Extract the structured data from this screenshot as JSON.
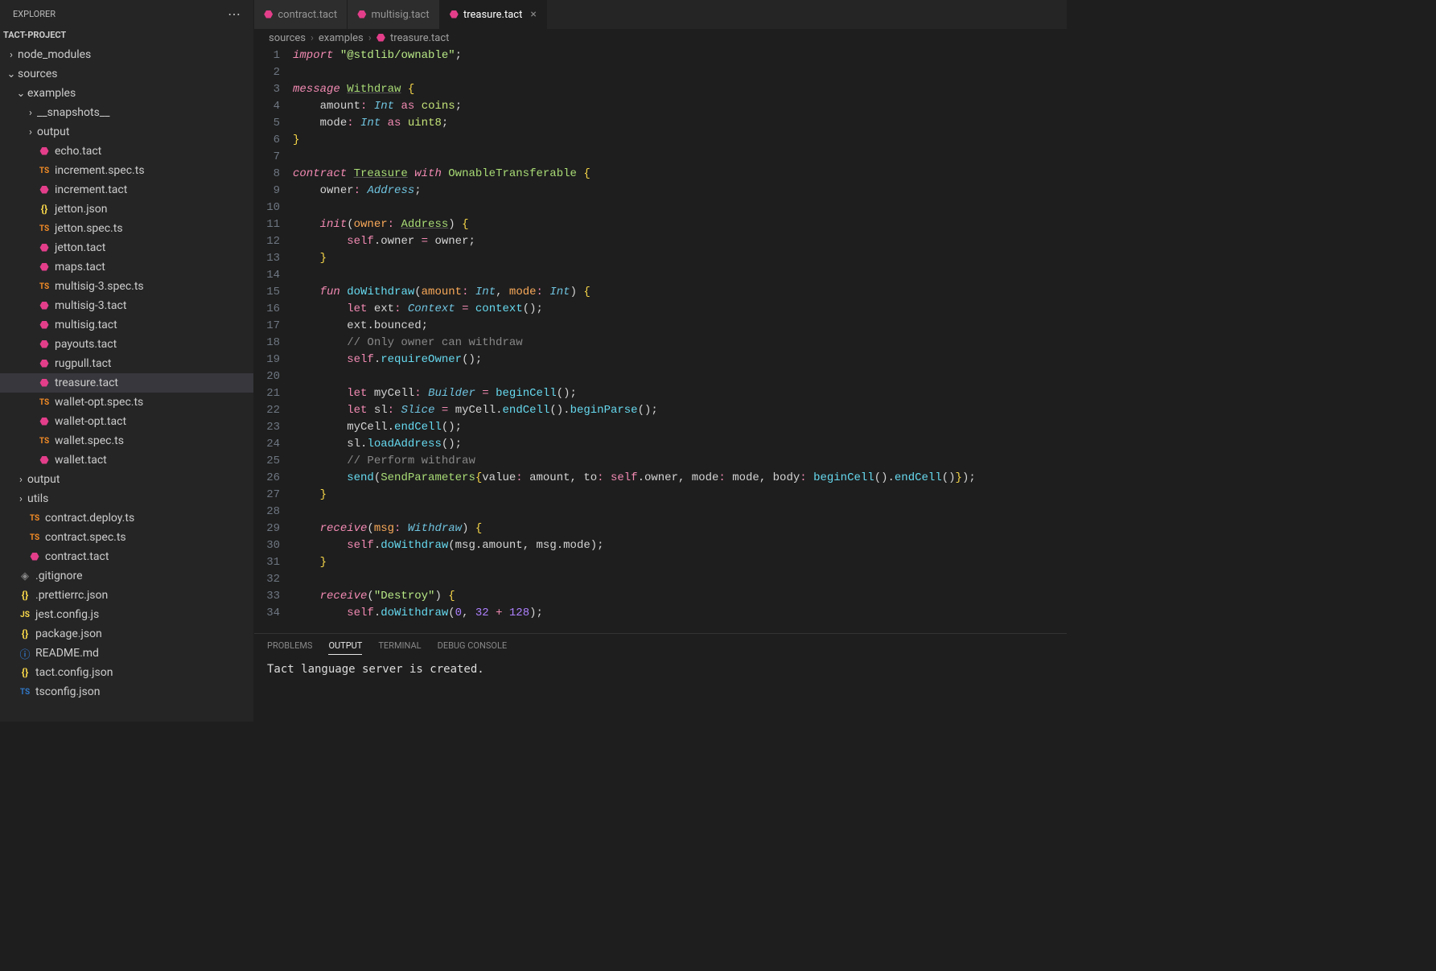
{
  "sidebar": {
    "title": "EXPLORER",
    "project": "TACT-PROJECT",
    "tree": [
      {
        "label": "node_modules",
        "type": "folder",
        "chev": "›",
        "indent": 1
      },
      {
        "label": "sources",
        "type": "folder",
        "chev": "⌄",
        "indent": 1
      },
      {
        "label": "examples",
        "type": "folder",
        "chev": "⌄",
        "indent": 2
      },
      {
        "label": "__snapshots__",
        "type": "folder",
        "chev": "›",
        "indent": 3
      },
      {
        "label": "output",
        "type": "folder",
        "chev": "›",
        "indent": 3
      },
      {
        "label": "echo.tact",
        "type": "tact",
        "indent": 3
      },
      {
        "label": "increment.spec.ts",
        "type": "ts",
        "indent": 3
      },
      {
        "label": "increment.tact",
        "type": "tact",
        "indent": 3
      },
      {
        "label": "jetton.json",
        "type": "json",
        "indent": 3
      },
      {
        "label": "jetton.spec.ts",
        "type": "ts",
        "indent": 3
      },
      {
        "label": "jetton.tact",
        "type": "tact",
        "indent": 3
      },
      {
        "label": "maps.tact",
        "type": "tact",
        "indent": 3
      },
      {
        "label": "multisig-3.spec.ts",
        "type": "ts",
        "indent": 3
      },
      {
        "label": "multisig-3.tact",
        "type": "tact",
        "indent": 3
      },
      {
        "label": "multisig.tact",
        "type": "tact",
        "indent": 3
      },
      {
        "label": "payouts.tact",
        "type": "tact",
        "indent": 3
      },
      {
        "label": "rugpull.tact",
        "type": "tact",
        "indent": 3
      },
      {
        "label": "treasure.tact",
        "type": "tact",
        "indent": 3,
        "active": true
      },
      {
        "label": "wallet-opt.spec.ts",
        "type": "ts",
        "indent": 3
      },
      {
        "label": "wallet-opt.tact",
        "type": "tact",
        "indent": 3
      },
      {
        "label": "wallet.spec.ts",
        "type": "ts",
        "indent": 3
      },
      {
        "label": "wallet.tact",
        "type": "tact",
        "indent": 3
      },
      {
        "label": "output",
        "type": "folder",
        "chev": "›",
        "indent": 2
      },
      {
        "label": "utils",
        "type": "folder",
        "chev": "›",
        "indent": 2
      },
      {
        "label": "contract.deploy.ts",
        "type": "ts",
        "indent": 2
      },
      {
        "label": "contract.spec.ts",
        "type": "ts",
        "indent": 2
      },
      {
        "label": "contract.tact",
        "type": "tact",
        "indent": 2
      },
      {
        "label": ".gitignore",
        "type": "git",
        "indent": 1
      },
      {
        "label": ".prettierrc.json",
        "type": "json",
        "indent": 1
      },
      {
        "label": "jest.config.js",
        "type": "js",
        "indent": 1
      },
      {
        "label": "package.json",
        "type": "json",
        "indent": 1
      },
      {
        "label": "README.md",
        "type": "info",
        "indent": 1
      },
      {
        "label": "tact.config.json",
        "type": "json",
        "indent": 1
      },
      {
        "label": "tsconfig.json",
        "type": "tstype",
        "indent": 1
      }
    ]
  },
  "tabs": [
    {
      "label": "contract.tact",
      "active": false
    },
    {
      "label": "multisig.tact",
      "active": false
    },
    {
      "label": "treasure.tact",
      "active": true
    }
  ],
  "breadcrumb": {
    "seg1": "sources",
    "seg2": "examples",
    "seg3": "treasure.tact"
  },
  "panel": {
    "tab0": "PROBLEMS",
    "tab1": "OUTPUT",
    "tab2": "TERMINAL",
    "tab3": "DEBUG CONSOLE",
    "output": "Tact language server is created."
  },
  "code": {
    "lines": 34
  }
}
